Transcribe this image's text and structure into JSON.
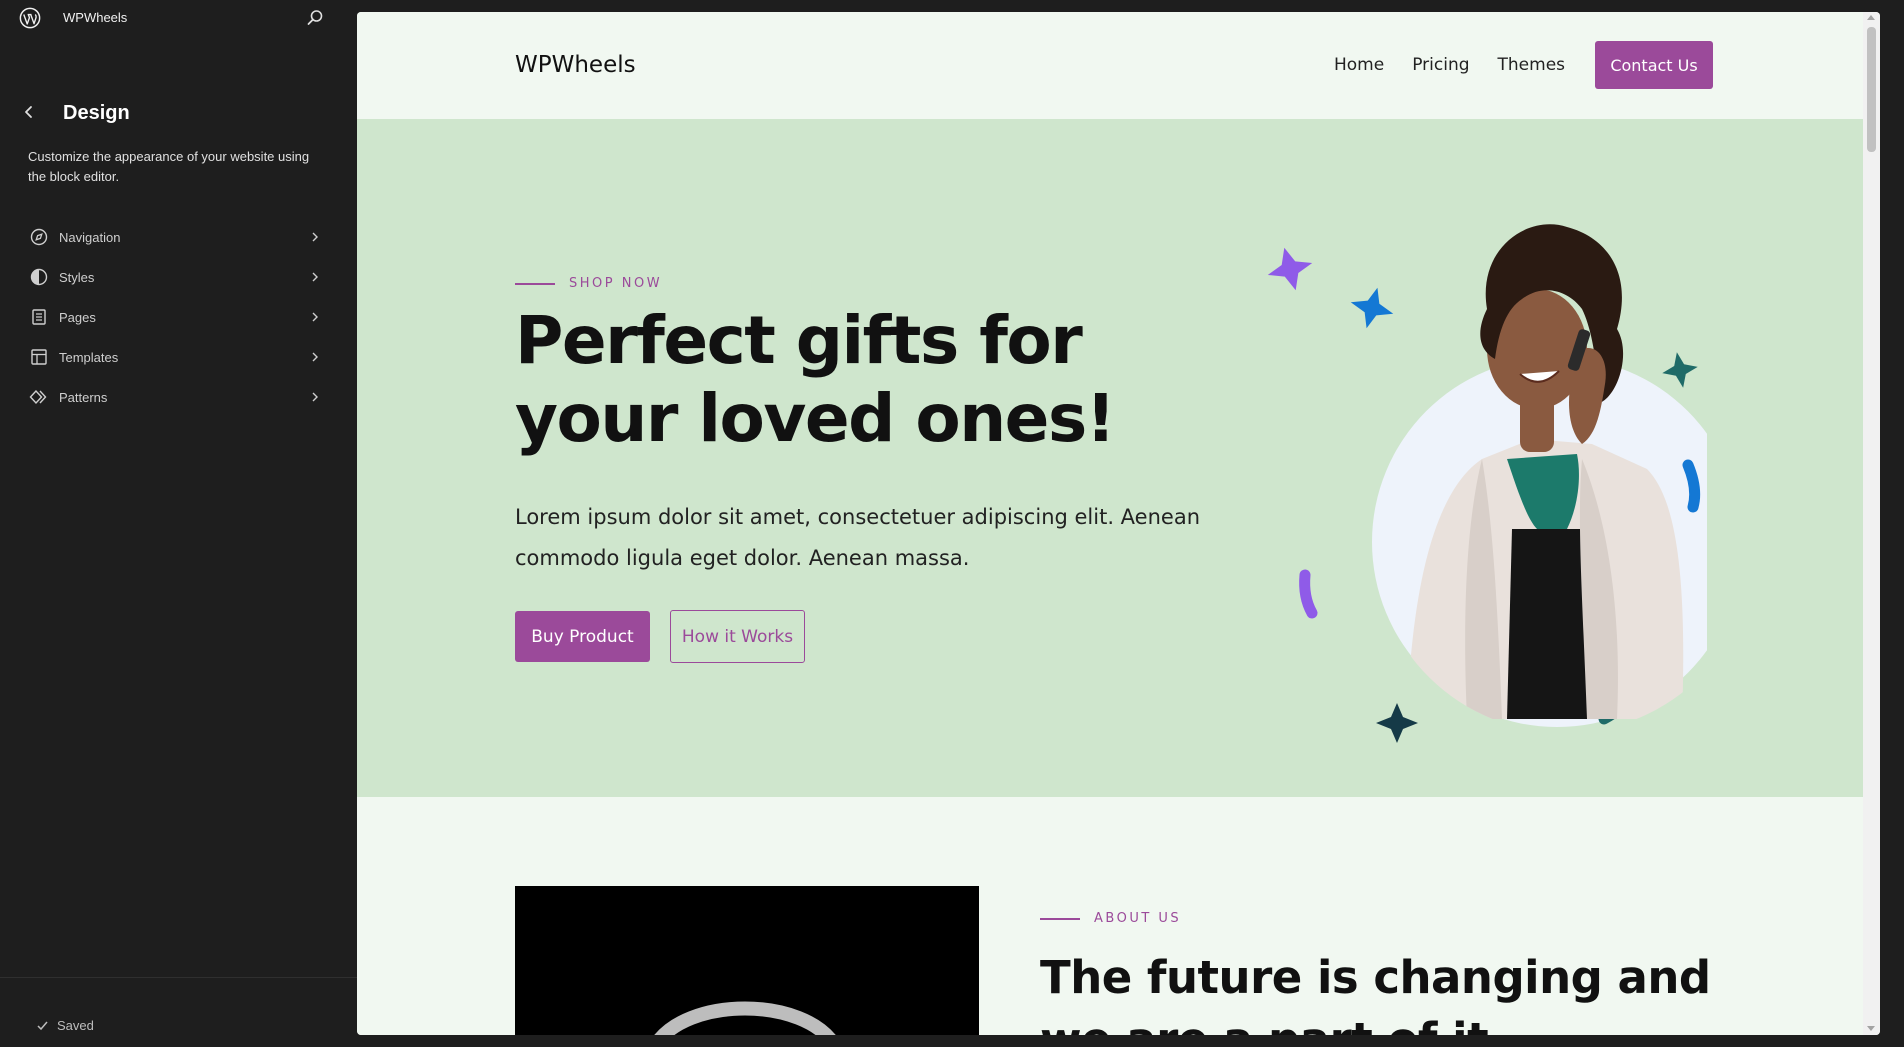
{
  "sidebar": {
    "site_name": "WPWheels",
    "panel_title": "Design",
    "panel_description": "Customize the appearance of your website using the block editor.",
    "items": [
      {
        "label": "Navigation",
        "icon": "compass-icon"
      },
      {
        "label": "Styles",
        "icon": "half-circle-icon"
      },
      {
        "label": "Pages",
        "icon": "page-icon"
      },
      {
        "label": "Templates",
        "icon": "layout-icon"
      },
      {
        "label": "Patterns",
        "icon": "diamond-icon"
      }
    ],
    "status": "Saved"
  },
  "site": {
    "brand": "WPWheels",
    "nav": [
      "Home",
      "Pricing",
      "Themes"
    ],
    "cta": "Contact Us"
  },
  "hero": {
    "eyebrow": "SHOP NOW",
    "title": "Perfect gifts for your loved ones!",
    "text": "Lorem ipsum dolor sit amet, consectetuer adipiscing elit. Aenean commodo ligula eget dolor. Aenean massa.",
    "primary_button": "Buy Product",
    "secondary_button": "How it Works"
  },
  "about": {
    "eyebrow": "ABOUT US",
    "title": "The future is changing and we are a part of it"
  },
  "colors": {
    "accent": "#9b4a9a",
    "hero_bg": "#cfe6cd",
    "page_bg": "#f1f8f1",
    "admin_bg": "#1e1e1e"
  }
}
